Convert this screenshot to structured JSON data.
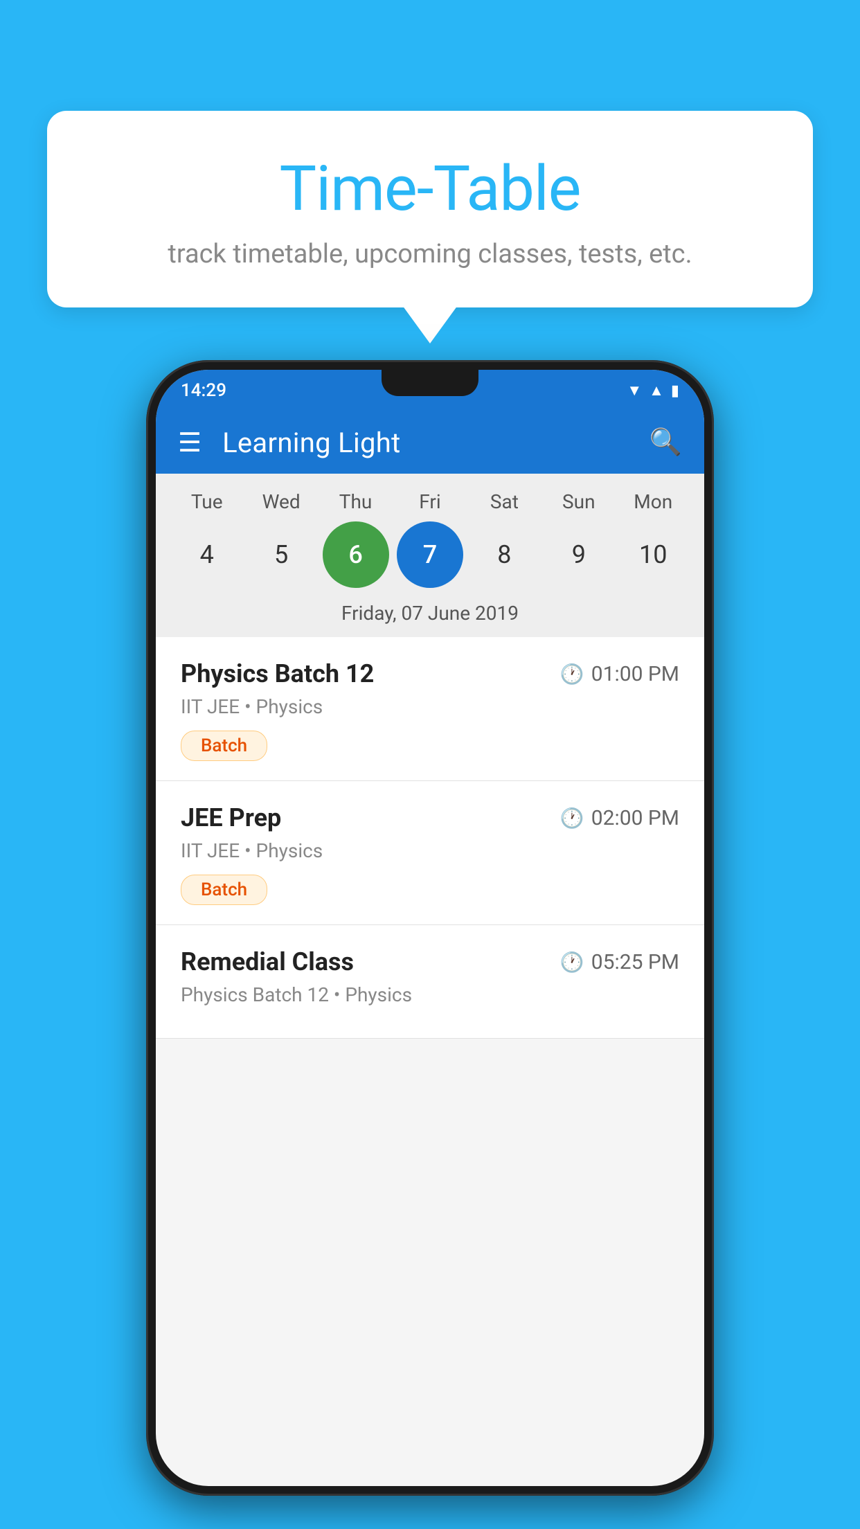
{
  "background_color": "#29b6f6",
  "bubble": {
    "title": "Time-Table",
    "subtitle": "track timetable, upcoming classes, tests, etc."
  },
  "status_bar": {
    "time": "14:29",
    "icons": [
      "wifi",
      "signal",
      "battery"
    ]
  },
  "app_bar": {
    "title": "Learning Light",
    "menu_icon": "☰",
    "search_icon": "🔍"
  },
  "calendar": {
    "days": [
      {
        "label": "Tue",
        "number": "4"
      },
      {
        "label": "Wed",
        "number": "5"
      },
      {
        "label": "Thu",
        "number": "6",
        "state": "today"
      },
      {
        "label": "Fri",
        "number": "7",
        "state": "selected"
      },
      {
        "label": "Sat",
        "number": "8"
      },
      {
        "label": "Sun",
        "number": "9"
      },
      {
        "label": "Mon",
        "number": "10"
      }
    ],
    "selected_date_label": "Friday, 07 June 2019"
  },
  "schedule": [
    {
      "title": "Physics Batch 12",
      "time": "01:00 PM",
      "meta": "IIT JEE • Physics",
      "badge": "Batch"
    },
    {
      "title": "JEE Prep",
      "time": "02:00 PM",
      "meta": "IIT JEE • Physics",
      "badge": "Batch"
    },
    {
      "title": "Remedial Class",
      "time": "05:25 PM",
      "meta": "Physics Batch 12 • Physics",
      "badge": null
    }
  ]
}
